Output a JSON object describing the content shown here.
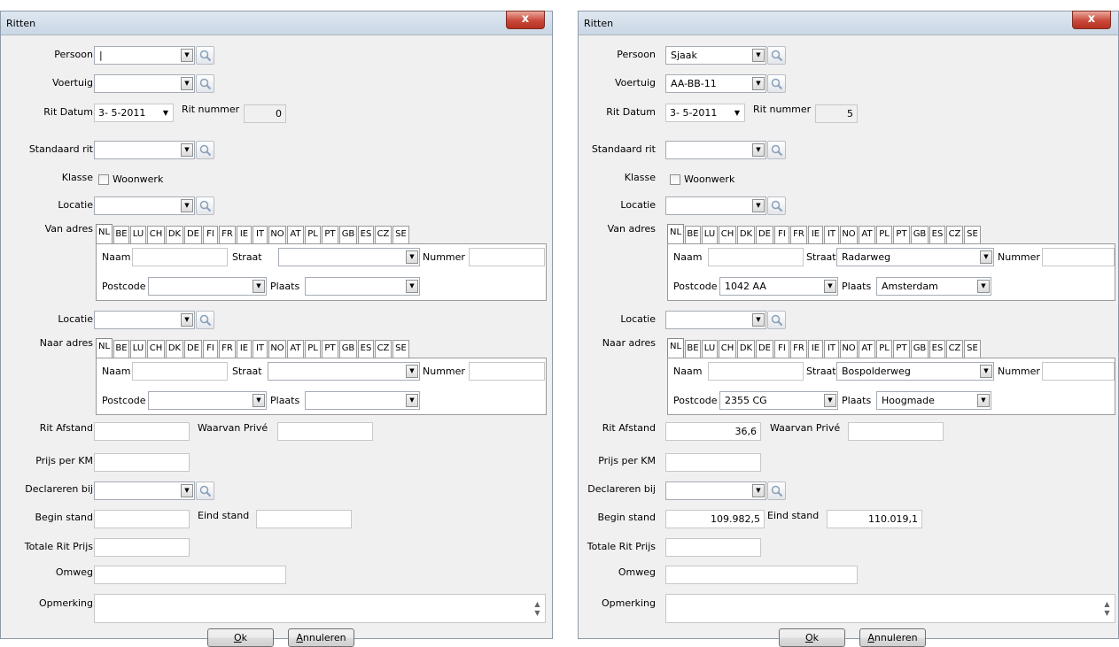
{
  "windows": [
    {
      "title": "Ritten",
      "close_label": "x",
      "labels": {
        "persoon": "Persoon",
        "voertuig": "Voertuig",
        "rit_datum": "Rit Datum",
        "rit_nummer": "Rit nummer",
        "standaard_rit": "Standaard rit",
        "klasse": "Klasse",
        "woonwerk": "Woonwerk",
        "locatie": "Locatie",
        "van_adres": "Van adres",
        "naar_adres": "Naar adres",
        "naam": "Naam",
        "straat": "Straat",
        "nummer": "Nummer",
        "postcode": "Postcode",
        "plaats": "Plaats",
        "rit_afstand": "Rit Afstand",
        "waarvan_prive": "Waarvan Privé",
        "prijs_per_km": "Prijs per KM",
        "declareren_bij": "Declareren bij",
        "begin_stand": "Begin stand",
        "eind_stand": "Eind stand",
        "totale_rit_prijs": "Totale Rit Prijs",
        "omweg": "Omweg",
        "opmerking": "Opmerking"
      },
      "values": {
        "persoon": "|",
        "voertuig": "",
        "rit_datum": "3- 5-2011",
        "rit_nummer": "0",
        "standaard_rit": "",
        "locatie_van": "",
        "van_naam": "",
        "van_straat": "",
        "van_nummer": "",
        "van_postcode": "",
        "van_plaats": "",
        "locatie_naar": "",
        "naar_naam": "",
        "naar_straat": "",
        "naar_nummer": "",
        "naar_postcode": "",
        "naar_plaats": "",
        "rit_afstand": "",
        "waarvan_prive": "",
        "prijs_per_km": "",
        "declareren_bij": "",
        "begin_stand": "",
        "eind_stand": "",
        "totale_rit_prijs": "",
        "omweg": "",
        "opmerking": ""
      },
      "buttons": {
        "ok_prefix": "",
        "ok_u": "O",
        "ok_rest": "k",
        "cancel_u": "A",
        "cancel_rest": "nnuleren"
      }
    },
    {
      "title": "Ritten",
      "close_label": "x",
      "labels": {
        "persoon": "Persoon",
        "voertuig": "Voertuig",
        "rit_datum": "Rit Datum",
        "rit_nummer": "Rit nummer",
        "standaard_rit": "Standaard rit",
        "klasse": "Klasse",
        "woonwerk": "Woonwerk",
        "locatie": "Locatie",
        "van_adres": "Van adres",
        "naar_adres": "Naar adres",
        "naam": "Naam",
        "straat": "Straat",
        "nummer": "Nummer",
        "postcode": "Postcode",
        "plaats": "Plaats",
        "rit_afstand": "Rit Afstand",
        "waarvan_prive": "Waarvan Privé",
        "prijs_per_km": "Prijs per KM",
        "declareren_bij": "Declareren bij",
        "begin_stand": "Begin stand",
        "eind_stand": "Eind stand",
        "totale_rit_prijs": "Totale Rit Prijs",
        "omweg": "Omweg",
        "opmerking": "Opmerking"
      },
      "values": {
        "persoon": "Sjaak",
        "voertuig": "AA-BB-11",
        "rit_datum": "3- 5-2011",
        "rit_nummer": "5",
        "standaard_rit": "",
        "locatie_van": "",
        "van_naam": "",
        "van_straat": "Radarweg",
        "van_nummer": "",
        "van_postcode": "1042 AA",
        "van_plaats": "Amsterdam",
        "locatie_naar": "",
        "naar_naam": "",
        "naar_straat": "Bospolderweg",
        "naar_nummer": "",
        "naar_postcode": "2355 CG",
        "naar_plaats": "Hoogmade",
        "rit_afstand": "36,6",
        "waarvan_prive": "",
        "prijs_per_km": "",
        "declareren_bij": "",
        "begin_stand": "109.982,5",
        "eind_stand": "110.019,1",
        "totale_rit_prijs": "",
        "omweg": "",
        "opmerking": ""
      },
      "buttons": {
        "ok_prefix": "",
        "ok_u": "O",
        "ok_rest": "k",
        "cancel_u": "A",
        "cancel_rest": "nnuleren"
      }
    }
  ],
  "country_tabs": [
    "NL",
    "BE",
    "LU",
    "CH",
    "DK",
    "DE",
    "FI",
    "FR",
    "IE",
    "IT",
    "NO",
    "AT",
    "PL",
    "PT",
    "GB",
    "ES",
    "CZ",
    "SE"
  ],
  "colors": {
    "title_bar": "#c9d6e4",
    "close_button": "#c9483a",
    "window_bg": "#f0f0f0"
  }
}
